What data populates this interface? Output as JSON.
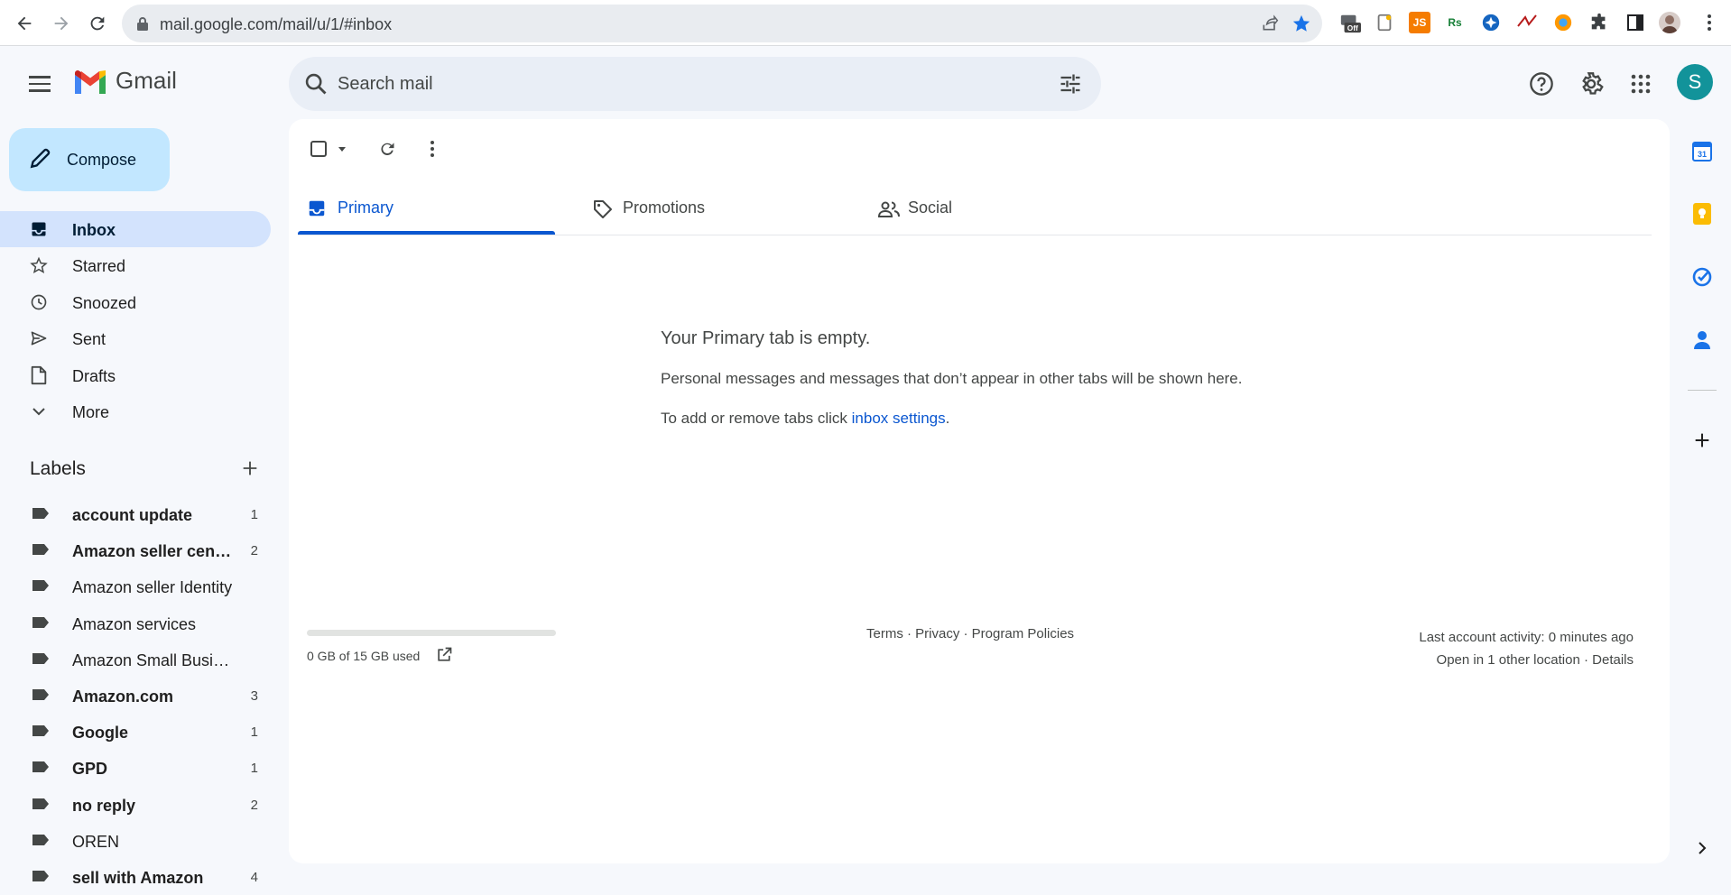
{
  "browser": {
    "url": "mail.google.com/mail/u/1/#inbox",
    "ext_badge_off": "Off",
    "ext_js": "JS",
    "ext_rs": "Rs"
  },
  "header": {
    "app_name": "Gmail",
    "search_placeholder": "Search mail",
    "avatar_letter": "S"
  },
  "sidebar": {
    "compose_label": "Compose",
    "nav": [
      {
        "label": "Inbox",
        "icon": "inbox-icon",
        "active": true
      },
      {
        "label": "Starred",
        "icon": "star-icon"
      },
      {
        "label": "Snoozed",
        "icon": "clock-icon"
      },
      {
        "label": "Sent",
        "icon": "send-icon"
      },
      {
        "label": "Drafts",
        "icon": "draft-icon"
      },
      {
        "label": "More",
        "icon": "chevron-down-icon"
      }
    ],
    "labels_heading": "Labels",
    "labels": [
      {
        "name": "account update",
        "count": "1",
        "bold": true
      },
      {
        "name": "Amazon seller central",
        "count": "2",
        "bold": true
      },
      {
        "name": "Amazon seller Identity",
        "count": "",
        "bold": false
      },
      {
        "name": "Amazon services",
        "count": "",
        "bold": false
      },
      {
        "name": "Amazon Small Business",
        "count": "",
        "bold": false
      },
      {
        "name": "Amazon.com",
        "count": "3",
        "bold": true
      },
      {
        "name": "Google",
        "count": "1",
        "bold": true
      },
      {
        "name": "GPD",
        "count": "1",
        "bold": true
      },
      {
        "name": "no reply",
        "count": "2",
        "bold": true
      },
      {
        "name": "OREN",
        "count": "",
        "bold": false
      },
      {
        "name": "sell with Amazon",
        "count": "4",
        "bold": true
      }
    ]
  },
  "tabs": [
    {
      "label": "Primary",
      "icon": "inbox-tab-icon",
      "active": true
    },
    {
      "label": "Promotions",
      "icon": "tag-icon"
    },
    {
      "label": "Social",
      "icon": "people-icon"
    }
  ],
  "empty_state": {
    "title": "Your Primary tab is empty.",
    "message": "Personal messages and messages that don’t appear in other tabs will be shown here.",
    "hint_prefix": "To add or remove tabs click ",
    "hint_link": "inbox settings",
    "hint_suffix": "."
  },
  "footer": {
    "storage": "0 GB of 15 GB used",
    "storage_fraction": 0,
    "links": "Terms · Privacy · Program Policies",
    "activity": "Last account activity: 0 minutes ago",
    "location": "Open in 1 other location · Details"
  },
  "colors": {
    "accent": "#0b57d0",
    "compose_bg": "#c2e7ff",
    "active_nav_bg": "#d3e3fd",
    "avatar_bg": "#12939a"
  }
}
